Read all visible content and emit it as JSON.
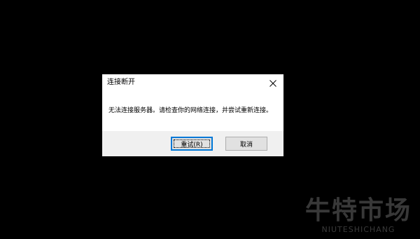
{
  "dialog": {
    "title": "连接断开",
    "message": "无法连接服务器。请检查你的网络连接，并尝试重新连接。",
    "buttons": {
      "retry_label": "重试(R)",
      "cancel_label": "取消"
    },
    "close_icon": "close-icon"
  },
  "watermark": {
    "chinese": "牛特市场",
    "english": "NIUTESHICHANG"
  },
  "colors": {
    "background": "#000000",
    "dialog_bg": "#f0f0f0",
    "content_bg": "#ffffff",
    "default_button_border": "#0078d7"
  }
}
